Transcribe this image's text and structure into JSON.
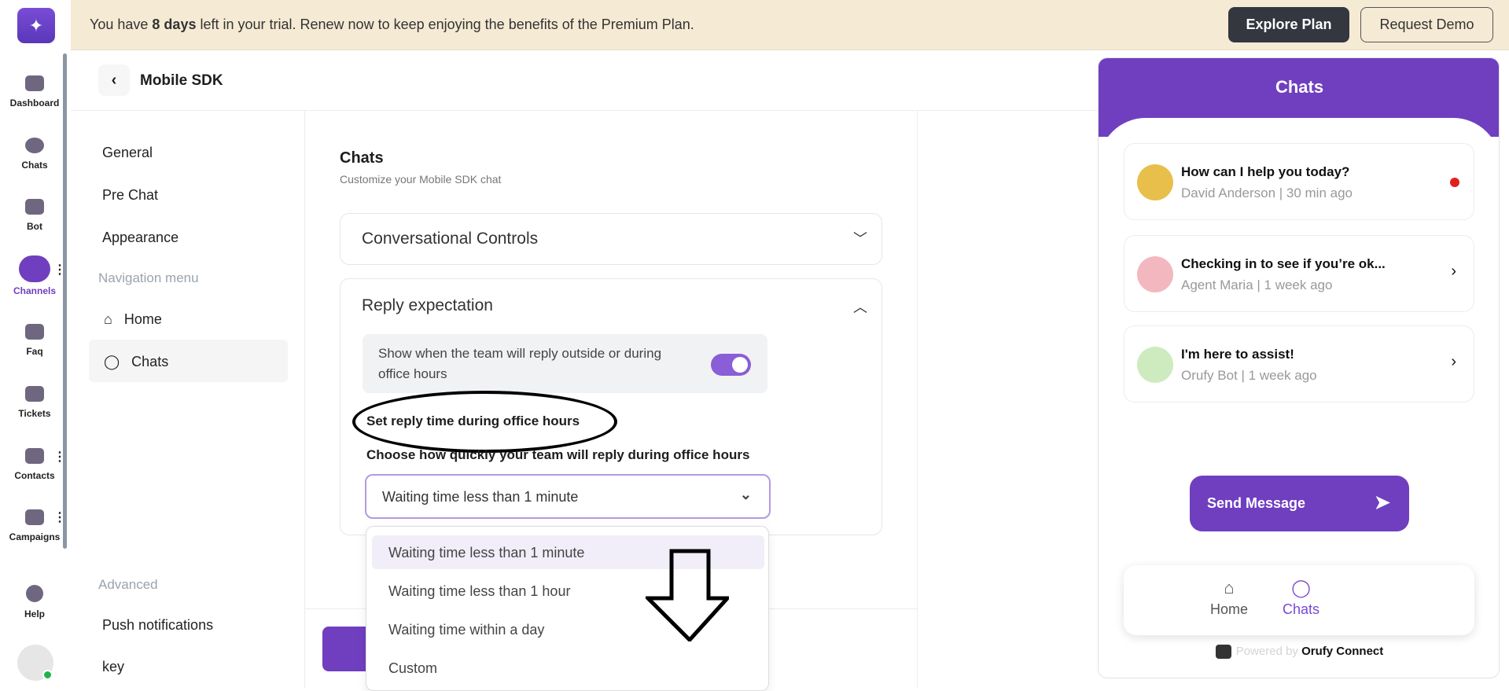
{
  "rail": {
    "items": [
      {
        "label": "Dashboard",
        "icon": "dashboard-icon"
      },
      {
        "label": "Chats",
        "icon": "chats-icon"
      },
      {
        "label": "Bot",
        "icon": "bot-icon"
      },
      {
        "label": "Channels",
        "icon": "channels-icon",
        "active": true
      },
      {
        "label": "Faq",
        "icon": "faq-icon"
      },
      {
        "label": "Tickets",
        "icon": "tickets-icon"
      },
      {
        "label": "Contacts",
        "icon": "contacts-icon"
      },
      {
        "label": "Campaigns",
        "icon": "campaigns-icon"
      },
      {
        "label": "Help",
        "icon": "help-icon"
      }
    ],
    "kebab": "⋮"
  },
  "banner": {
    "prefix": "You have ",
    "days": "8 days",
    "suffix": " left in your trial. Renew now to keep enjoying the benefits of the Premium Plan.",
    "explore_label": "Explore Plan",
    "demo_label": "Request Demo"
  },
  "header": {
    "back": "‹",
    "title": "Mobile SDK"
  },
  "nav": {
    "general": "General",
    "pre_chat": "Pre Chat",
    "appearance": "Appearance",
    "nav_menu_heading": "Navigation menu",
    "home": "Home",
    "chats": "Chats",
    "advanced_heading": "Advanced",
    "push": "Push notifications",
    "key": "key"
  },
  "main": {
    "title": "Chats",
    "subtitle": "Customize your Mobile SDK chat",
    "conv_controls": "Conversational Controls",
    "reply_expectation": "Reply expectation",
    "toggle_text": "Show when the team will reply outside or during office hours",
    "toggle_on": true,
    "set_label": "Set reply time during office hours",
    "choose_label": "Choose how quickly your team will reply during office hours",
    "select_value": "Waiting time less than 1 minute",
    "options": [
      "Waiting time less than 1 minute",
      "Waiting time less than 1 hour",
      "Waiting time within a day",
      "Custom"
    ]
  },
  "widget": {
    "title": "Chats",
    "chats": [
      {
        "title": "How can I help you today?",
        "meta": "David Anderson | 30 min ago",
        "unread": true
      },
      {
        "title": "Checking in to see if you’re ok...",
        "meta": "Agent Maria | 1 week ago"
      },
      {
        "title": "I'm here to assist!",
        "meta": "Orufy Bot | 1 week ago"
      }
    ],
    "send_label": "Send Message",
    "nav_home": "Home",
    "nav_chats": "Chats",
    "powered_by": "Powered by",
    "brand": "Orufy Connect"
  },
  "colors": {
    "accent": "#6f3fc0",
    "banner": "#f5ead4",
    "dark_button": "#343640"
  }
}
